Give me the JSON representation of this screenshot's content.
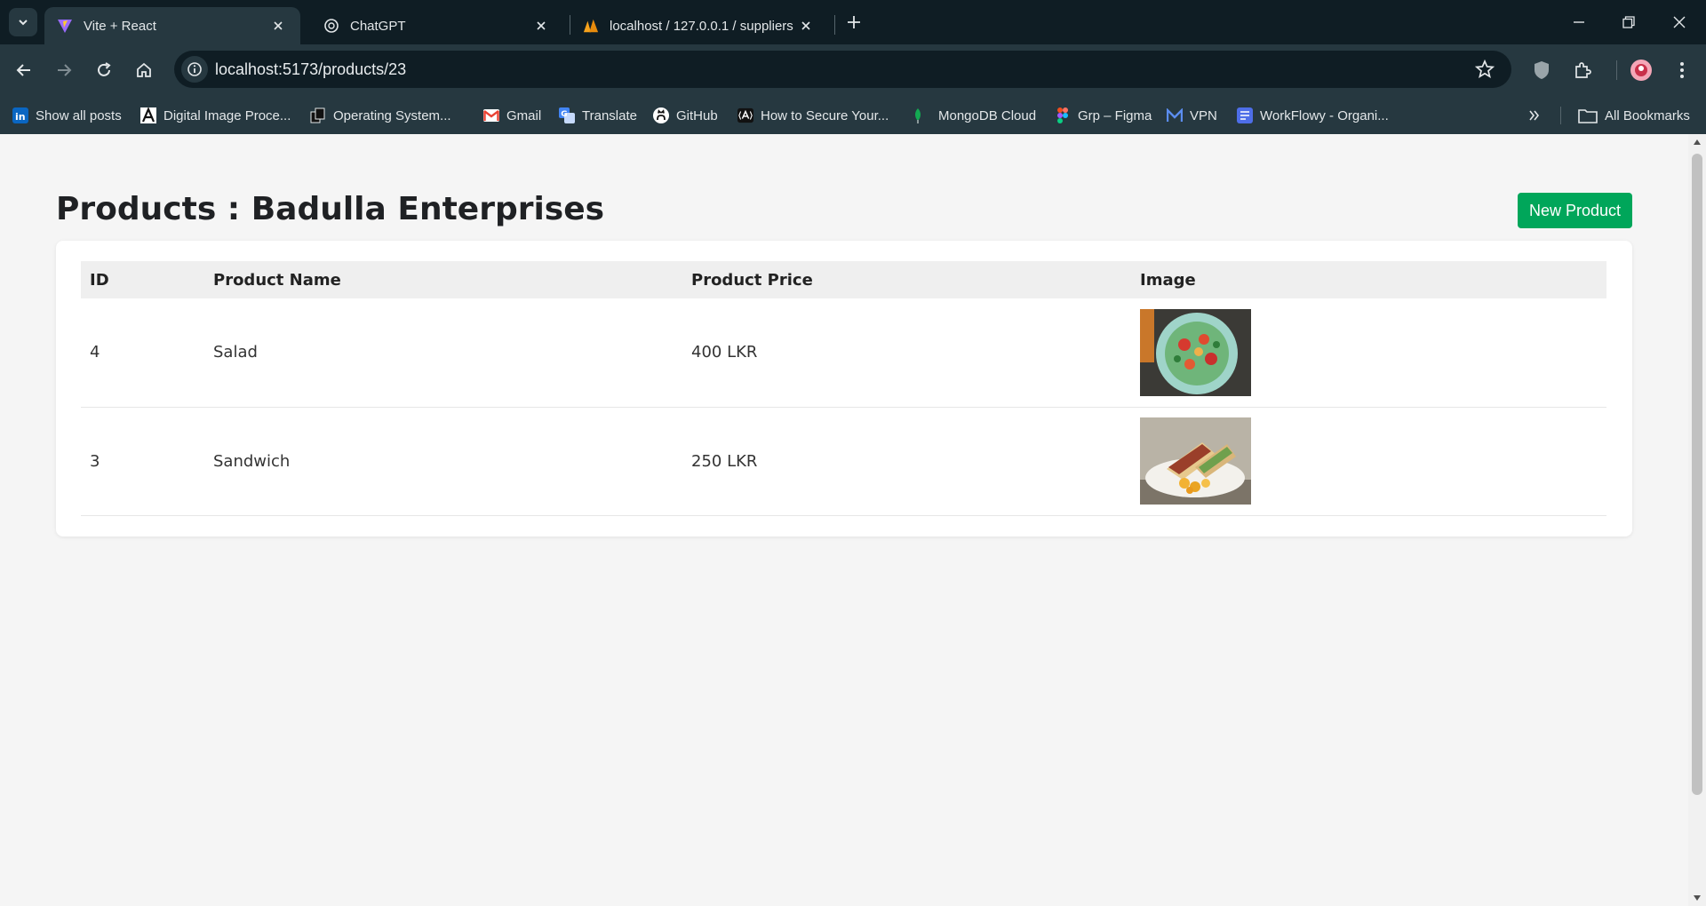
{
  "browser": {
    "tabs": [
      {
        "title": "Vite + React",
        "icon": "vite-icon",
        "active": true
      },
      {
        "title": "ChatGPT",
        "icon": "chatgpt-icon",
        "active": false
      },
      {
        "title": "localhost / 127.0.0.1 / suppliers",
        "icon": "phpmyadmin-icon",
        "active": false
      }
    ],
    "url": "localhost:5173/products/23",
    "bookmarks": [
      {
        "label": "Show all posts",
        "icon": "linkedin-icon"
      },
      {
        "label": "Digital Image Proce...",
        "icon": "a-logo-icon"
      },
      {
        "label": "Operating System...",
        "icon": "doc-icon"
      },
      {
        "label": "Gmail",
        "icon": "gmail-icon"
      },
      {
        "label": "Translate",
        "icon": "translate-icon"
      },
      {
        "label": "GitHub",
        "icon": "github-icon"
      },
      {
        "label": "How to Secure Your...",
        "icon": "auth0-icon"
      },
      {
        "label": "MongoDB Cloud",
        "icon": "mongodb-icon"
      },
      {
        "label": "Grp – Figma",
        "icon": "figma-icon"
      },
      {
        "label": "VPN",
        "icon": "m-logo-icon"
      },
      {
        "label": "WorkFlowy - Organi...",
        "icon": "workflowy-icon"
      }
    ],
    "all_bookmarks": "All Bookmarks"
  },
  "page": {
    "title": "Products : Badulla Enterprises",
    "new_button": "New Product",
    "columns": [
      "ID",
      "Product Name",
      "Product Price",
      "Image"
    ],
    "rows": [
      {
        "id": "4",
        "name": "Salad",
        "price": "400 LKR",
        "image": "salad-photo"
      },
      {
        "id": "3",
        "name": "Sandwich",
        "price": "250 LKR",
        "image": "sandwich-photo"
      }
    ]
  },
  "colors": {
    "accent": "#00a65a",
    "chrome_dark": "#0f1d24",
    "chrome_toolbar": "#263840",
    "page_bg": "#f5f5f5"
  }
}
